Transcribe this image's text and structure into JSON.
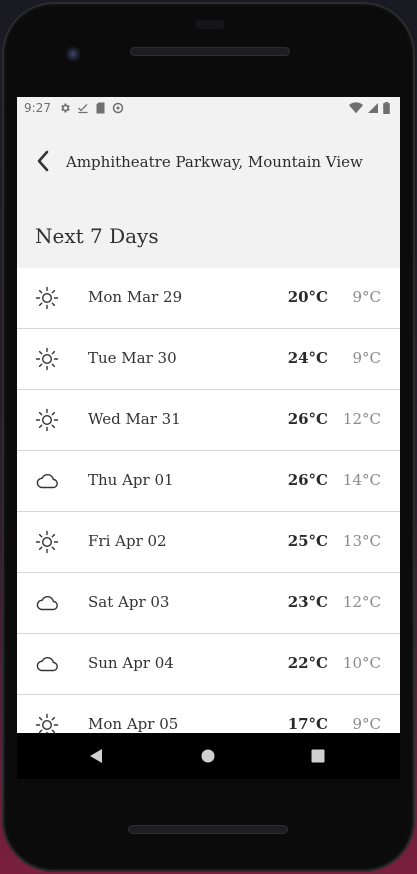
{
  "status_bar": {
    "time": "9:27",
    "left_icons": [
      "gear-icon",
      "check-download-icon",
      "sd-card-icon",
      "data-saver-icon"
    ],
    "right_icons": [
      "wifi-icon",
      "signal-icon",
      "battery-icon"
    ]
  },
  "app_bar": {
    "title": "Amphitheatre Parkway, Mountain View",
    "back_icon": "arrow-back-icon"
  },
  "section": {
    "title": "Next 7 Days"
  },
  "forecast": [
    {
      "icon": "sun-icon",
      "date": "Mon Mar 29",
      "high": "20°C",
      "low": "9°C"
    },
    {
      "icon": "sun-icon",
      "date": "Tue Mar 30",
      "high": "24°C",
      "low": "9°C"
    },
    {
      "icon": "sun-icon",
      "date": "Wed Mar 31",
      "high": "26°C",
      "low": "12°C"
    },
    {
      "icon": "cloud-icon",
      "date": "Thu Apr 01",
      "high": "26°C",
      "low": "14°C"
    },
    {
      "icon": "sun-icon",
      "date": "Fri Apr 02",
      "high": "25°C",
      "low": "13°C"
    },
    {
      "icon": "cloud-icon",
      "date": "Sat Apr 03",
      "high": "23°C",
      "low": "12°C"
    },
    {
      "icon": "cloud-icon",
      "date": "Sun Apr 04",
      "high": "22°C",
      "low": "10°C"
    },
    {
      "icon": "sun-icon",
      "date": "Mon Apr 05",
      "high": "17°C",
      "low": "9°C"
    }
  ],
  "navigation": {
    "buttons": [
      "back-triangle-icon",
      "home-circle-icon",
      "recents-square-icon"
    ]
  }
}
